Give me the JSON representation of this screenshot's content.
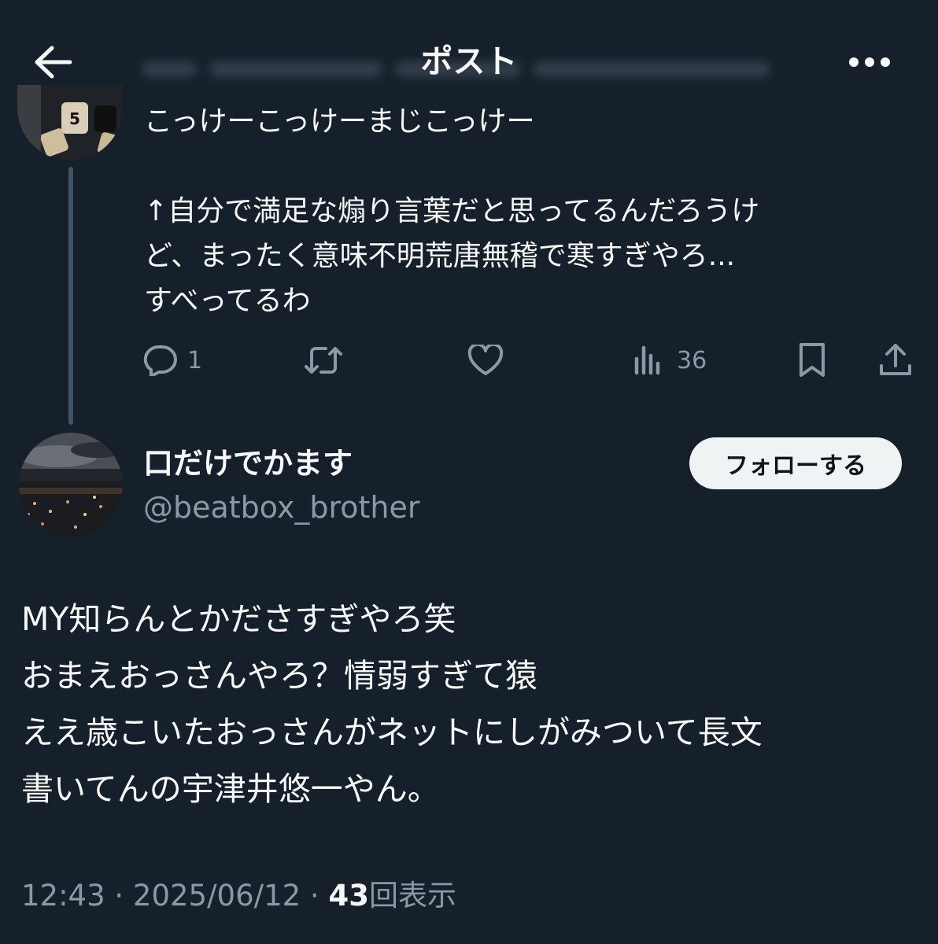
{
  "header": {
    "title": "ポスト",
    "back_icon": "arrow-left-icon",
    "more_icon": "more-horizontal-icon"
  },
  "parent_post": {
    "lines": [
      "こっけーこっけーまじこっけー",
      "",
      "↑自分で満足な煽り言葉だと思ってるんだろうけ",
      "ど、まったく意味不明荒唐無稽で寒すぎやろ...",
      "すべってるわ"
    ],
    "actions": {
      "reply_count": "1",
      "retweet_count": "",
      "like_count": "",
      "views_count": "36"
    }
  },
  "reply_post": {
    "display_name": "口だけでかます",
    "handle": "@beatbox_brother",
    "follow_label": "フォローする",
    "lines": [
      "MY知らんとかださすぎやろ笑",
      "おまえおっさんやろ？情弱すぎて猿",
      "ええ歳こいたおっさんがネットにしがみついて長文",
      "書いてんの宇津井悠一やん。"
    ],
    "time": "12:43 · 2025/06/12 · ",
    "views_count": "43",
    "views_label": "回表示"
  },
  "colors": {
    "background": "#15202b",
    "text": "#f7f9f9",
    "secondary": "#8b98a5",
    "thread_line": "#425364",
    "follow_bg": "#eff3f4"
  }
}
